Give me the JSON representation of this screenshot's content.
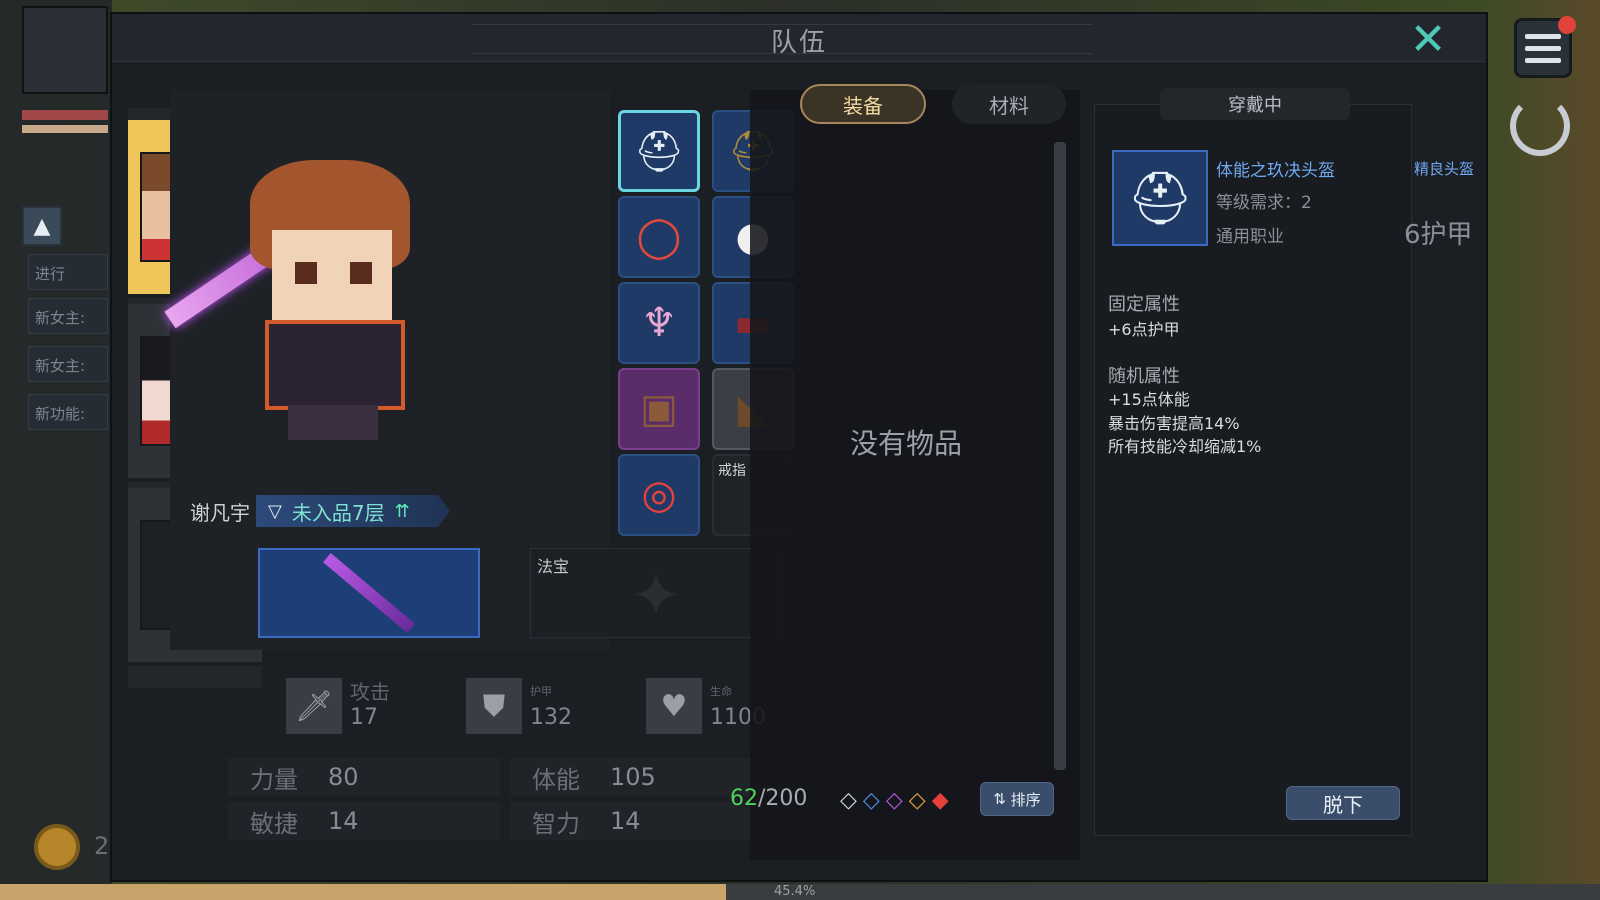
{
  "window": {
    "title": "队伍",
    "close_icon": "close-icon"
  },
  "hud": {
    "quest_btn": "进行",
    "quests": [
      "新女主:",
      "新女主:",
      "新功能:"
    ],
    "coin_prefix": "2",
    "progress_pct": "45.4%"
  },
  "roster": {
    "members": [
      {
        "name": "hero-portrait",
        "selected": true
      },
      {
        "name": "heroine-portrait",
        "selected": false,
        "notify": true
      },
      {
        "name": "locked-slot",
        "placeholder": "?"
      }
    ]
  },
  "character": {
    "name": "谢凡宇",
    "rank": "未入品7层"
  },
  "equipment": {
    "slots": [
      {
        "id": "helmet",
        "icon": "helmet-icon",
        "rarity": "blue",
        "selected": true
      },
      {
        "id": "helmet-alt",
        "icon": "dark-helmet-icon",
        "rarity": "blue"
      },
      {
        "id": "necklace",
        "icon": "necklace-icon",
        "rarity": "blue"
      },
      {
        "id": "pet",
        "icon": "sheep-icon",
        "rarity": "blue"
      },
      {
        "id": "armor",
        "icon": "armor-icon",
        "rarity": "blue"
      },
      {
        "id": "belt",
        "icon": "belt-icon",
        "rarity": "blue"
      },
      {
        "id": "bracer",
        "icon": "bracer-icon",
        "rarity": "purple"
      },
      {
        "id": "boots",
        "icon": "boots-icon",
        "rarity": "grey"
      },
      {
        "id": "ring",
        "icon": "ring-icon",
        "rarity": "blue"
      },
      {
        "id": "ring-empty",
        "label": "戒指",
        "rarity": "empty"
      }
    ],
    "weapon_icon": "sword-icon",
    "treasure_label": "法宝"
  },
  "stats": {
    "attack": {
      "label": "攻击",
      "value": "17"
    },
    "armor": {
      "label": "护甲",
      "value": "132"
    },
    "life": {
      "label": "生命",
      "value": "1100"
    }
  },
  "attributes": [
    {
      "name": "力量",
      "value": "80"
    },
    {
      "name": "体能",
      "value": "105"
    },
    {
      "name": "敏捷",
      "value": "14"
    },
    {
      "name": "智力",
      "value": "14"
    }
  ],
  "inventory": {
    "tabs": [
      "装备",
      "材料"
    ],
    "active_tab": "装备",
    "empty_text": "没有物品",
    "used": "62",
    "capacity": "/200",
    "filters": [
      "◇",
      "◇",
      "◇",
      "◇",
      "◆"
    ],
    "sort_label": "排序"
  },
  "detail": {
    "tab": "穿戴中",
    "item_name": "体能之玖决头盔",
    "item_type": "精良头盔",
    "level_req": "等级需求：2",
    "class_req": "通用职业",
    "armor_text": "6护甲",
    "fixed_title": "固定属性",
    "fixed_lines": [
      "+6点护甲"
    ],
    "random_title": "随机属性",
    "random_lines": [
      "+15点体能",
      "暴击伤害提高14%",
      "所有技能冷却缩减1%"
    ],
    "unequip_label": "脱下"
  },
  "colors": {
    "accent_teal": "#4ec9b8",
    "item_blue": "#6fa7f0",
    "used_green": "#4fd15b",
    "selected_gold": "#f0c65a"
  }
}
